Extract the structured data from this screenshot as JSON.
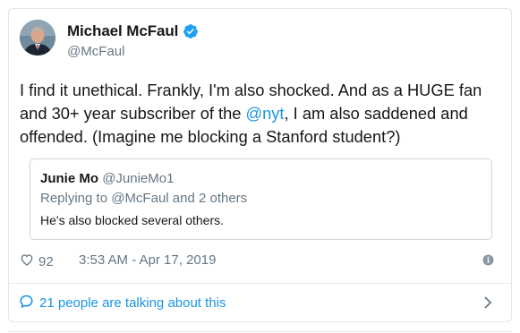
{
  "author": {
    "display_name": "Michael McFaul",
    "handle": "@McFaul",
    "verified_icon": "verified-badge-icon"
  },
  "tweet": {
    "text_before_mention": "I find it unethical. Frankly, I'm also shocked. And as a HUGE fan and 30+ year subscriber of the ",
    "mention": "@nyt",
    "text_after_mention": ", I am also saddened and offended. (Imagine me blocking a Stanford student?)"
  },
  "quote": {
    "name": "Junie Mo",
    "handle": "@JunieMo1",
    "replying_to": "Replying to @McFaul and 2 others",
    "body": "He's also blocked several others."
  },
  "meta": {
    "like_count": "92",
    "timestamp": "3:53 AM - Apr 17, 2019"
  },
  "footer": {
    "talking_label": "21 people are talking about this"
  },
  "colors": {
    "accent": "#1b95e0",
    "secondary_text": "#657786",
    "border": "#e1e8ed"
  }
}
